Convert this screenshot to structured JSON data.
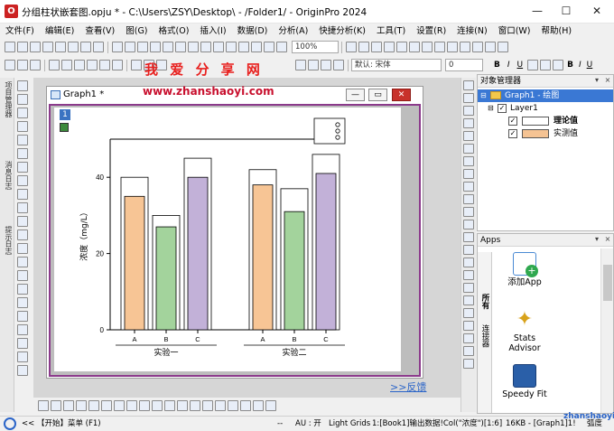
{
  "window": {
    "title": "分组柱状嵌套图.opju * - C:\\Users\\ZSY\\Desktop\\ - /Folder1/ - OriginPro 2024",
    "icon_letter": "O"
  },
  "menu": [
    "文件(F)",
    "编辑(E)",
    "查看(V)",
    "图(G)",
    "格式(O)",
    "插入(I)",
    "数据(D)",
    "分析(A)",
    "快捷分析(K)",
    "工具(T)",
    "设置(R)",
    "连接(N)",
    "窗口(W)",
    "帮助(H)"
  ],
  "toolbar": {
    "zoom": "100%",
    "font": "默认: 宋体",
    "font_size": "0",
    "bold": "B",
    "italic": "I",
    "underline": "U",
    "format_letters": [
      "B",
      "I",
      "U"
    ]
  },
  "watermark": {
    "brand": "我 爱 分 享 网",
    "url": "www.zhanshaoyi.com",
    "corner": "zhanshaoyi.com"
  },
  "left_vtabs": [
    "项目管理器",
    "消息日志",
    "提示日志"
  ],
  "graph_window": {
    "title": "Graph1 *",
    "layer_number": "1"
  },
  "chart_data": {
    "type": "bar",
    "title": "",
    "ylabel": "浓度（mg/L）",
    "ylim": [
      0,
      50
    ],
    "yticks": [
      0,
      20,
      40
    ],
    "groups": [
      {
        "name": "实验一",
        "categories": [
          "A",
          "B",
          "C"
        ]
      },
      {
        "name": "实验二",
        "categories": [
          "A",
          "B",
          "C"
        ]
      }
    ],
    "series": [
      {
        "name": "理论值",
        "color": "#ffffff",
        "values": [
          40,
          30,
          45,
          42,
          37,
          46
        ]
      },
      {
        "name": "实测值",
        "color": "#f5c393",
        "values": [
          35,
          27,
          40,
          38,
          31,
          41
        ]
      }
    ],
    "inner_colors": [
      "#f7c595",
      "#a3d39c",
      "#c2b1d8"
    ]
  },
  "feedback": ">>反馈",
  "object_manager": {
    "title": "对象管理器",
    "graph": "Graph1 - 绘图",
    "layer": "Layer1",
    "plots": [
      {
        "name": "理论值",
        "color": "#ffffff"
      },
      {
        "name": "实测值",
        "color": "#f5c393"
      }
    ]
  },
  "apps": {
    "title": "Apps",
    "tabs": [
      "所有",
      "连接器"
    ],
    "items": [
      "添加App",
      "Stats Advisor",
      "Speedy Fit"
    ]
  },
  "status": {
    "start": "<<  【开始】菜单 (F1)",
    "mode": "--",
    "au": "AU : 开",
    "grids": "Light Grids",
    "col": "1:[Book1]输出数据!Col(\"浓度\")[1:6]",
    "size": "16KB - [Graph1]1!",
    "angle": "弧度"
  }
}
